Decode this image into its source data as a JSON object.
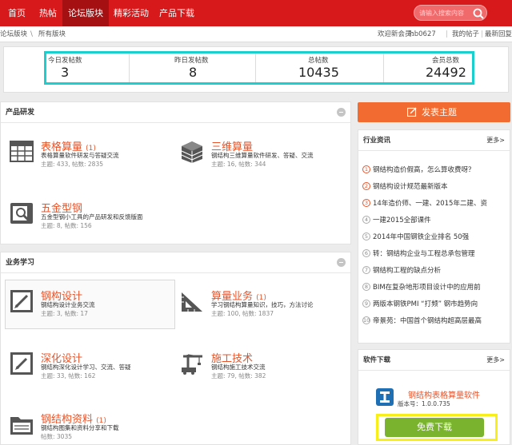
{
  "nav": {
    "items": [
      "首页",
      "热帖",
      "论坛版块",
      "精彩活动",
      "产品下载"
    ],
    "active_index": 2,
    "search_placeholder": "请输入搜索内容"
  },
  "breadcrumb": {
    "root": "论坛版块",
    "sep": "\\",
    "current": "所有版块"
  },
  "userbar": {
    "welcome": "欢迎新会员:",
    "username": "lhb0627",
    "my_posts": "我的帖子",
    "latest_replies": "最新回复"
  },
  "stats": [
    {
      "label": "今日发帖数",
      "value": "3"
    },
    {
      "label": "昨日发帖数",
      "value": "8"
    },
    {
      "label": "总帖数",
      "value": "10435"
    },
    {
      "label": "会员总数",
      "value": "24492"
    }
  ],
  "sections": [
    {
      "title": "产品研发",
      "forums": [
        {
          "title": "表格算量",
          "count": "(1)",
          "desc": "表格算量软件研发与答疑交流",
          "stat": "主题: 433, 帖数: 2835",
          "icon": "table-icon"
        },
        {
          "title": "三维算量",
          "count": "",
          "desc": "钢结构三维算量软件研发、答疑、交流",
          "stat": "主题: 16, 帖数: 344",
          "icon": "3d-building-icon"
        },
        {
          "title": "五金型钢",
          "count": "",
          "desc": "五金型钢小工具的产品研发和反馈版面",
          "stat": "主题: 8, 帖数: 156",
          "icon": "hardware-icon"
        }
      ]
    },
    {
      "title": "业务学习",
      "forums": [
        {
          "title": "钢构设计",
          "count": "",
          "desc": "钢结构设计业务交流",
          "stat": "主题: 3, 帖数: 17",
          "icon": "design-doc-icon"
        },
        {
          "title": "算量业务",
          "count": "(1)",
          "desc": "学习钢结构算量知识，技巧，方法讨论",
          "stat": "主题: 100, 帖数: 1837",
          "icon": "triangle-ruler-icon"
        },
        {
          "title": "深化设计",
          "count": "",
          "desc": "钢结构深化设计学习、交流、答疑",
          "stat": "主题: 33, 帖数: 162",
          "icon": "pencil-doc-icon"
        },
        {
          "title": "施工技术",
          "count": "",
          "desc": "钢结构施工技术交流",
          "stat": "主题: 79, 帖数: 382",
          "icon": "crane-icon"
        },
        {
          "title": "钢结构资料",
          "count": "(1)",
          "desc": "钢结构图集和资料分享和下载",
          "stat": "帖数: 3035",
          "icon": "folder-icon"
        }
      ]
    }
  ],
  "post_button": "发表主题",
  "news": {
    "title": "行业资讯",
    "more": "更多>",
    "items": [
      "钢结构造价假高，怎么算收费呀？",
      "钢结构设计规范最新版本",
      "14年造价师、一建、2015年二建、资",
      "一建2015全部课件",
      "2014年中国钢铁企业排名 50强",
      "转：钢结构企业与工程总承包管理",
      "钢结构工程的缺点分析",
      "BIM在复杂地形项目设计中的应用前",
      "两版本钢铁PMI “打频” 钢市趋势向",
      "帝景苑：中国首个钢结构超高层最高"
    ]
  },
  "download": {
    "title": "软件下载",
    "more": "更多>",
    "software_name": "钢结构表格算量软件",
    "version": "版本号：1.0.0.735",
    "button": "免费下载"
  },
  "colors": {
    "nav_red": "#d8191b",
    "accent_orange": "#e8542a",
    "download_green": "#7ab32e",
    "highlight_cyan": "#1ccfcf",
    "highlight_yellow": "#f7ee1a"
  }
}
